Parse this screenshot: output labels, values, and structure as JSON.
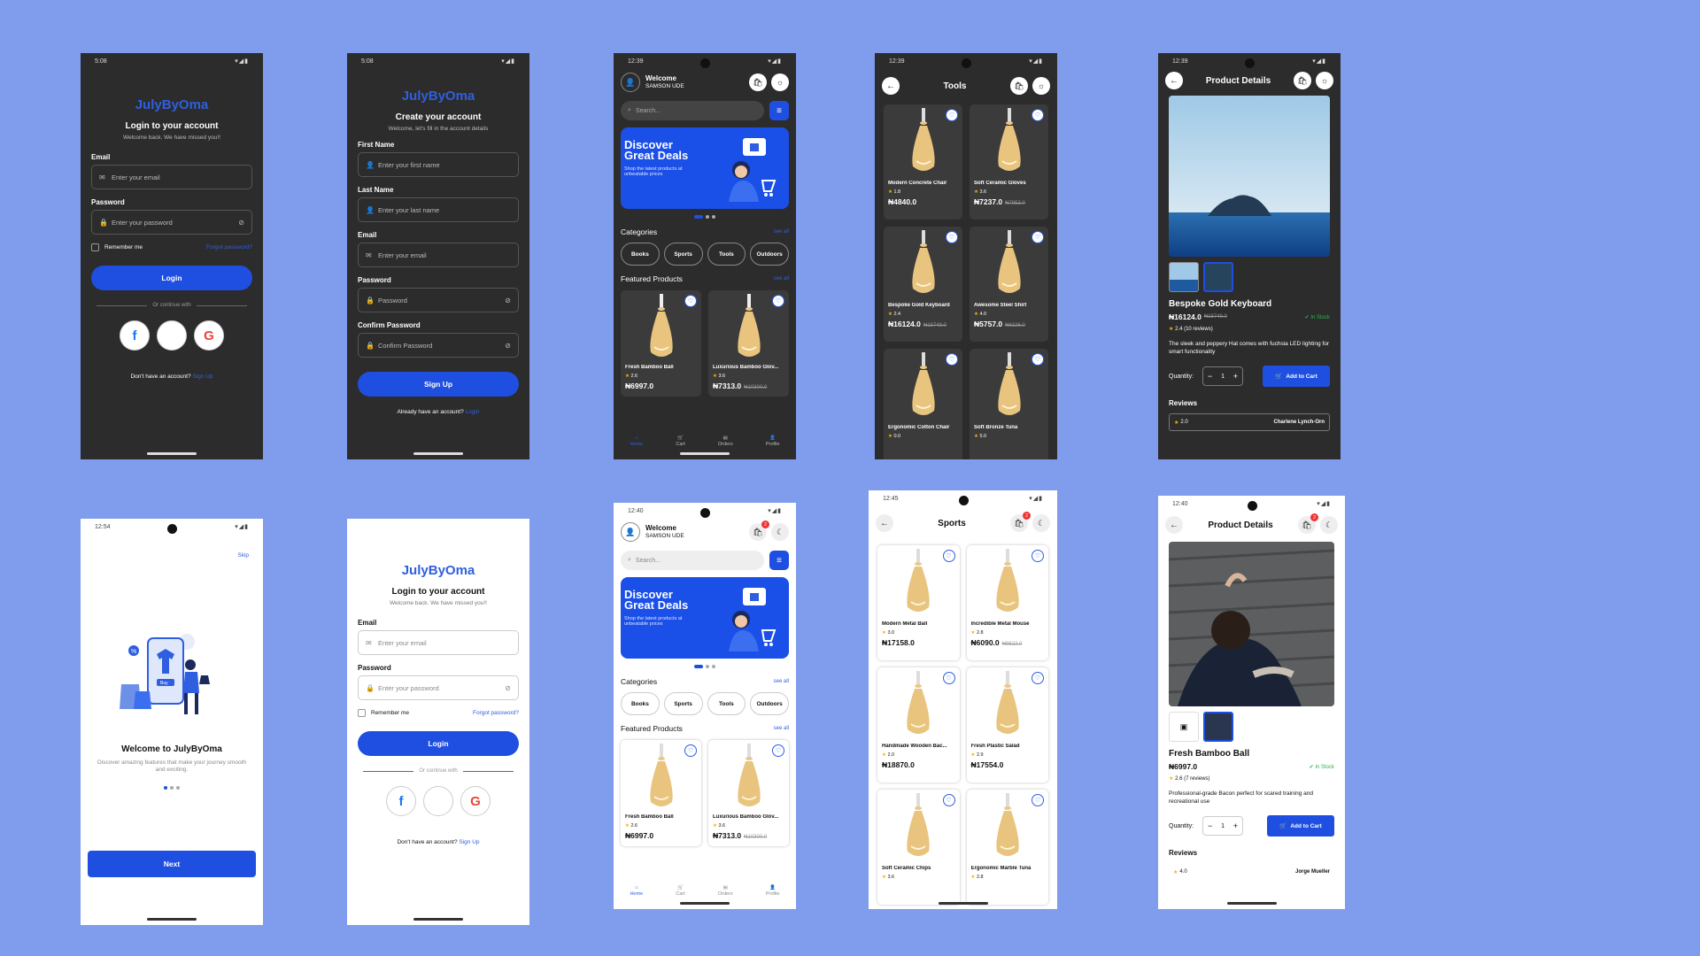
{
  "brand": "JulyByOma",
  "login_dark": {
    "status_time": "5:08",
    "title": "Login to your account",
    "subtitle": "Welcome back. We have missed you!!",
    "email_label": "Email",
    "email_placeholder": "Enter your email",
    "password_label": "Password",
    "password_placeholder": "Enter your password",
    "remember": "Remember me",
    "forgot": "Forgot password?",
    "login_btn": "Login",
    "continue_with": "Or continue with",
    "no_account": "Don't have an account?",
    "signup_link": "Sign Up"
  },
  "signup": {
    "status_time": "5:08",
    "title": "Create your account",
    "subtitle": "Welcome, let's fill in the account details",
    "first_label": "First Name",
    "first_placeholder": "Enter your first name",
    "last_label": "Last Name",
    "last_placeholder": "Enter your last name",
    "email_label": "Email",
    "email_placeholder": "Enter your email",
    "password_label": "Password",
    "password_placeholder": "Password",
    "confirm_label": "Confirm Password",
    "confirm_placeholder": "Confirm Password",
    "signup_btn": "Sign Up",
    "have_account": "Already have an account?",
    "login_link": "Login"
  },
  "home": {
    "welcome": "Welcome",
    "user": "SAMSON UDE",
    "search_placeholder": "Search...",
    "banner_title": "Discover Great Deals",
    "banner_text": "Shop the latest products at unbeatable prices",
    "categories_label": "Categories",
    "featured_label": "Featured Products",
    "see_all": "see all",
    "categories": [
      "Books",
      "Sports",
      "Tools",
      "Outdoors"
    ],
    "products": [
      {
        "name": "Fresh Bamboo Ball",
        "rating": "2.6",
        "price": "₦6997.0",
        "old": ""
      },
      {
        "name": "Luxurious Bamboo Glov...",
        "rating": "3.6",
        "price": "₦7313.0",
        "old": "₦10300.0"
      }
    ],
    "nav": [
      "Home",
      "Cart",
      "Orders",
      "Profile"
    ]
  },
  "home_dark": {
    "status_time": "12:39"
  },
  "home_light": {
    "status_time": "12:40",
    "cart_badge": "2"
  },
  "tools": {
    "status_time": "12:39",
    "title": "Tools",
    "products": [
      {
        "name": "Modern Concrete Chair",
        "rating": "1.8",
        "price": "₦4840.0",
        "old": ""
      },
      {
        "name": "Soft Ceramic Gloves",
        "rating": "3.6",
        "price": "₦7237.0",
        "old": "₦7953.0"
      },
      {
        "name": "Bespoke Gold Keyboard",
        "rating": "2.4",
        "price": "₦16124.0",
        "old": "₦18749.0"
      },
      {
        "name": "Awesome Steel Shirt",
        "rating": "4.0",
        "price": "₦5757.0",
        "old": "₦6326.0"
      },
      {
        "name": "Ergonomic Cotton Chair",
        "rating": "0.0",
        "price": "",
        "old": ""
      },
      {
        "name": "Soft Bronze Tuna",
        "rating": "5.0",
        "price": "",
        "old": ""
      }
    ]
  },
  "sports": {
    "status_time": "12:45",
    "title": "Sports",
    "cart_badge": "2",
    "products": [
      {
        "name": "Modern Metal Ball",
        "rating": "3.0",
        "price": "₦17158.0",
        "old": ""
      },
      {
        "name": "Incredible Metal Mouse",
        "rating": "2.8",
        "price": "₦6090.0",
        "old": "₦9822.0"
      },
      {
        "name": "Handmade Wooden Bac...",
        "rating": "2.0",
        "price": "₦18870.0",
        "old": ""
      },
      {
        "name": "Fresh Plastic Salad",
        "rating": "2.9",
        "price": "₦17554.0",
        "old": ""
      },
      {
        "name": "Soft Ceramic Chips",
        "rating": "3.6",
        "price": "",
        "old": ""
      },
      {
        "name": "Ergonomic Marble Tuna",
        "rating": "2.8",
        "price": "",
        "old": ""
      }
    ]
  },
  "detail_dark": {
    "status_time": "12:39",
    "title": "Product Details",
    "name": "Bespoke Gold Keyboard",
    "price": "₦16124.0",
    "old": "₦18749.0",
    "stock": "In Stock",
    "rating": "2.4 (10 reviews)",
    "desc": "The sleek and peppery Hat comes with fuchsia LED lighting for smart functionality",
    "quantity_label": "Quantity:",
    "qty": "1",
    "add_cart": "Add to Cart",
    "reviews_label": "Reviews",
    "review_rating": "2.0",
    "review_name": "Charlene Lynch-Orn"
  },
  "detail_light": {
    "status_time": "12:40",
    "title": "Product Details",
    "cart_badge": "2",
    "name": "Fresh Bamboo Ball",
    "price": "₦6997.0",
    "stock": "In Stock",
    "rating": "2.6 (7 reviews)",
    "desc": "Professional-grade Bacon perfect for scared training and recreational use",
    "quantity_label": "Quantity:",
    "qty": "1",
    "add_cart": "Add to Cart",
    "reviews_label": "Reviews",
    "review_rating": "4.0",
    "review_name": "Jorge Mueller"
  },
  "onboarding": {
    "status_time": "12:54",
    "skip": "Skip",
    "buy": "Buy",
    "title": "Welcome to JulyByOma",
    "text": "Discover amazing features that make your journey smooth and exciting.",
    "next": "Next"
  },
  "login_light": {
    "title": "Login to your account",
    "subtitle": "Welcome back. We have missed you!!",
    "email_label": "Email",
    "email_placeholder": "Enter your email",
    "password_label": "Password",
    "password_placeholder": "Enter your password",
    "remember": "Remember me",
    "forgot": "Forgot password?",
    "login_btn": "Login",
    "continue_with": "Or continue with",
    "no_account": "Don't have an account?",
    "signup_link": "Sign Up"
  },
  "colors": {
    "background": "#7f9ced",
    "accent": "#1f4fe0",
    "dark_surface": "#2c2c2c"
  }
}
